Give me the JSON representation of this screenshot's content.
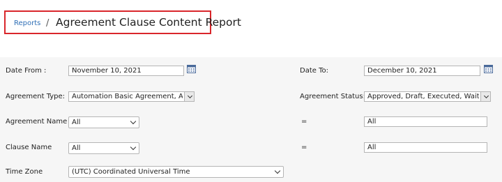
{
  "breadcrumb": {
    "link": "Reports",
    "separator": "/",
    "title": "Agreement Clause Content Report"
  },
  "filters": {
    "date_from": {
      "label": "Date From :",
      "value": "November 10, 2021"
    },
    "date_to": {
      "label": "Date To:",
      "value": "December 10, 2021"
    },
    "agreement_type": {
      "label": "Agreement Type:",
      "value": "Automation Basic Agreement, Autc"
    },
    "agreement_status": {
      "label": "Agreement Status:",
      "value": "Approved, Draft, Executed, Waiting"
    },
    "agreement_name": {
      "label": "Agreement Name",
      "value": "All",
      "operator": "=",
      "text": "All"
    },
    "clause_name": {
      "label": "Clause Name",
      "value": "All",
      "operator": "=",
      "text": "All"
    },
    "time_zone": {
      "label": "Time Zone",
      "value": "(UTC) Coordinated Universal Time"
    }
  },
  "icons": {
    "calendar": "calendar-icon",
    "dropdown": "chevron-down-icon"
  },
  "colors": {
    "highlight_border": "#d9262b",
    "link": "#2f6fb6",
    "panel_bg": "#f6f6f6"
  }
}
